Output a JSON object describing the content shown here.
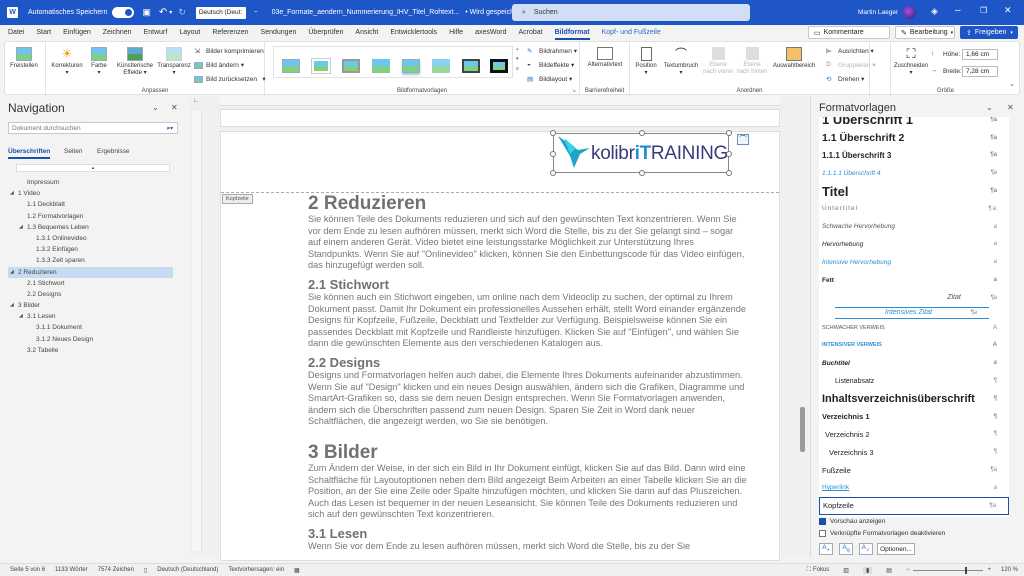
{
  "titlebar": {
    "autosave_label": "Automatisches Speichern",
    "autosave_state": "on",
    "language": "Deutsch (Deut:",
    "doc_title": "03e_Formate_aendern_Nummerierung_IHV_Titel_Rohtext...",
    "save_status": "• Wird gespeichert...",
    "search_placeholder": "Suchen",
    "user_name": "Martin Laeger",
    "icons": [
      "word-icon",
      "save-icon",
      "undo-icon",
      "redo-icon",
      "customize-icon",
      "diamond-icon",
      "minimize-icon",
      "restore-icon",
      "close-icon"
    ]
  },
  "menu": {
    "items": [
      "Datei",
      "Start",
      "Einfügen",
      "Zeichnen",
      "Entwurf",
      "Layout",
      "Referenzen",
      "Sendungen",
      "Überprüfen",
      "Ansicht",
      "Entwicklertools",
      "Hilfe",
      "axesWord",
      "Acrobat",
      "Bildformat",
      "Kopf- und Fußzeile"
    ],
    "active": "Bildformat",
    "comments": "Kommentare",
    "editing": "Bearbeitung",
    "share": "Freigeben"
  },
  "ribbon": {
    "freistellen": "Freistellen",
    "korrekturen": "Korrekturen",
    "farbe": "Farbe",
    "kuenstlerisch": "Künstlerische Effekte",
    "transparenz": "Transparenz",
    "komprimieren": "Bilder komprimieren",
    "aendern": "Bild ändern",
    "zuruecksetzen": "Bild zurücksetzen",
    "anpassen_group": "Anpassen",
    "bildformatvorlagen_group": "Bildformatvorlagen",
    "bildrahmen": "Bildrahmen",
    "bildeffekte": "Bildeffekte",
    "bildlayout": "Bildlayout",
    "alternativtext": "Alternativtext",
    "barrierefreiheit_group": "Barrierefreiheit",
    "position": "Position",
    "textumbruch": "Textumbruch",
    "ebene_vorne": "Ebene nach vorne",
    "ebene_hinten": "Ebene nach hinten",
    "auswahlbereich": "Auswahlbereich",
    "ausrichten": "Ausrichten",
    "gruppieren": "Gruppieren",
    "drehen": "Drehen",
    "anordnen_group": "Anordnen",
    "zuschneiden": "Zuschneiden",
    "hoehe_label": "Höhe:",
    "hoehe_value": "1,66 cm",
    "breite_label": "Breite:",
    "breite_value": "7,28 cm",
    "groesse_group": "Größe"
  },
  "navigation": {
    "title": "Navigation",
    "search_placeholder": "Dokument durchsuchen",
    "tabs": [
      "Überschriften",
      "Seiten",
      "Ergebnisse"
    ],
    "active_tab": "Überschriften",
    "tree": [
      {
        "label": "Impressum",
        "level": 1,
        "expander": false
      },
      {
        "label": "1 Video",
        "level": 0,
        "expander": true
      },
      {
        "label": "1.1 Deckblatt",
        "level": 1,
        "expander": false
      },
      {
        "label": "1.2 Formatvorlagen",
        "level": 1,
        "expander": false
      },
      {
        "label": "1.3 Bequemes Leben",
        "level": 1,
        "expander": true
      },
      {
        "label": "1.3.1 Onlinevideo",
        "level": 2,
        "expander": false
      },
      {
        "label": "1.3.2 Einfügen",
        "level": 2,
        "expander": false
      },
      {
        "label": "1.3.3 Zeit sparen",
        "level": 2,
        "expander": false
      },
      {
        "label": "2 Reduzieren",
        "level": 0,
        "expander": true,
        "selected": true
      },
      {
        "label": "2.1 Stichwort",
        "level": 1,
        "expander": false
      },
      {
        "label": "2.2 Designs",
        "level": 1,
        "expander": false
      },
      {
        "label": "3 Bilder",
        "level": 0,
        "expander": true
      },
      {
        "label": "3.1 Lesen",
        "level": 1,
        "expander": true
      },
      {
        "label": "3.1.1 Dokument",
        "level": 2,
        "expander": false
      },
      {
        "label": "3.1.2 Neues Design",
        "level": 2,
        "expander": false
      },
      {
        "label": "3.2 Tabelle",
        "level": 1,
        "expander": false
      }
    ]
  },
  "document": {
    "header_tag": "Kopfzeile",
    "logo_text_a": "kolibr",
    "logo_text_b": "iT",
    "logo_text_c": "RAINING",
    "blocks": [
      {
        "type": "h1",
        "text": "2 Reduzieren"
      },
      {
        "type": "p",
        "text": "Sie können Teile des Dokuments reduzieren und sich auf den gewünschten Text konzentrieren. Wenn Sie vor dem Ende zu lesen aufhören müssen, merkt sich Word die Stelle, bis zu der Sie gelangt sind – sogar auf einem anderen Gerät. Video bietet eine leistungsstarke Möglichkeit zur Unterstützung Ihres Standpunkts. Wenn Sie auf \"Onlinevideo\" klicken, können Sie den Einbettungscode für das Video einfügen, das hinzugefügt werden soll."
      },
      {
        "type": "h2",
        "text": "2.1 Stichwort"
      },
      {
        "type": "p",
        "text": "Sie können auch ein Stichwort eingeben, um online nach dem Videoclip zu suchen, der optimal zu Ihrem Dokument passt. Damit Ihr Dokument ein professionelles Aussehen erhält, stellt Word einander ergänzende Designs für Kopfzeile, Fußzeile, Deckblatt und Textfelder zur Verfügung. Beispielsweise können Sie ein passendes Deckblatt mit Kopfzeile und Randleiste hinzufügen. Klicken Sie auf \"Einfügen\", und wählen Sie dann die gewünschten Elemente aus den verschiedenen Katalogen aus."
      },
      {
        "type": "h2",
        "text": "2.2 Designs"
      },
      {
        "type": "p",
        "text": "Designs und Formatvorlagen helfen auch dabei, die Elemente Ihres Dokuments aufeinander abzustimmen. Wenn Sie auf \"Design\" klicken und ein neues Design auswählen, ändern sich die Grafiken, Diagramme und SmartArt-Grafiken so, dass sie dem neuen Design entsprechen. Wenn Sie Formatvorlagen anwenden, ändern sich die Überschriften passend zum neuen Design. Sparen Sie Zeit in Word dank neuer Schaltflächen, die angezeigt werden, wo Sie sie benötigen."
      },
      {
        "type": "h1",
        "text": "3 Bilder"
      },
      {
        "type": "p",
        "text": "Zum Ändern der Weise, in der sich ein Bild in Ihr Dokument einfügt, klicken Sie auf das Bild. Dann wird eine Schaltfläche für Layoutoptionen neben dem Bild angezeigt Beim Arbeiten an einer Tabelle klicken Sie an die Position, an der Sie eine Zeile oder Spalte hinzufügen möchten, und klicken Sie dann auf das Pluszeichen. Auch das Lesen ist bequemer in der neuen Leseansicht. Sie können Teile des Dokuments reduzieren und sich auf den gewünschten Text konzentrieren."
      },
      {
        "type": "h2",
        "text": "3.1 Lesen"
      },
      {
        "type": "p",
        "text": "Wenn Sie vor dem Ende zu lesen aufhören müssen, merkt sich Word die Stelle, bis zu der Sie"
      }
    ]
  },
  "styles": {
    "title": "Formatvorlagen",
    "items": [
      {
        "label": "1  Überschrift 1",
        "mark": "¶a",
        "style": "h1"
      },
      {
        "label": "1.1  Überschrift 2",
        "mark": "¶a",
        "style": "h2"
      },
      {
        "label": "1.1.1  Überschrift 3",
        "mark": "¶a",
        "style": "h3"
      },
      {
        "label": "1.1.1.1  Überschrift 4",
        "mark": "¶a",
        "style": "h4"
      },
      {
        "label": "Titel",
        "mark": "¶a",
        "style": "titel"
      },
      {
        "label": "Untertitel",
        "mark": "¶a",
        "style": "untertitel"
      },
      {
        "label": "Schwache Hervorhebung",
        "mark": "a",
        "style": "schwach"
      },
      {
        "label": "Hervorhebung",
        "mark": "a",
        "style": "herv"
      },
      {
        "label": "Intensive Hervorhebung",
        "mark": "a",
        "style": "intensiv"
      },
      {
        "label": "Fett",
        "mark": "a",
        "style": "fett"
      },
      {
        "label": "Zitat",
        "mark": "¶a",
        "style": "zitat"
      },
      {
        "label": "Intensives Zitat",
        "mark": "¶a",
        "style": "izitat"
      },
      {
        "label": "Schwacher Verweis",
        "mark": "a",
        "style": "sverweis"
      },
      {
        "label": "Intensiver Verweis",
        "mark": "a",
        "style": "iverweis"
      },
      {
        "label": "Buchtitel",
        "mark": "a",
        "style": "buch"
      },
      {
        "label": "Listenabsatz",
        "mark": "¶",
        "style": "liste"
      },
      {
        "label": "Inhaltsverzeichnisüberschrift",
        "mark": "¶",
        "style": "ivz"
      },
      {
        "label": "Verzeichnis 1",
        "mark": "¶",
        "style": "vz1"
      },
      {
        "label": "Verzeichnis 2",
        "mark": "¶",
        "style": "vz2"
      },
      {
        "label": "Verzeichnis 3",
        "mark": "¶",
        "style": "vz3"
      },
      {
        "label": "Fußzeile",
        "mark": "¶a",
        "style": "fuss"
      },
      {
        "label": "Hyperlink",
        "mark": "a",
        "style": "link"
      },
      {
        "label": "Kopfzeile",
        "mark": "¶a",
        "style": "kopf",
        "selected": true
      }
    ],
    "preview_label": "Vorschau anzeigen",
    "preview_checked": true,
    "linked_label": "Verknüpfte Formatvorlagen deaktivieren",
    "linked_checked": false,
    "options_label": "Optionen..."
  },
  "status": {
    "page": "Seite 5 von 6",
    "words": "1133 Wörter",
    "chars": "7574 Zeichen",
    "language": "Deutsch (Deutschland)",
    "predictions": "Textvorhersagen: ein",
    "focus": "Fokus",
    "zoom": "120 %",
    "zoom_slider_fraction": 0.6
  },
  "colors": {
    "titlebar": "#1f56c7",
    "accent": "#1b4fa8",
    "selection": "#c7dcf3",
    "link": "#2a8fd6"
  }
}
